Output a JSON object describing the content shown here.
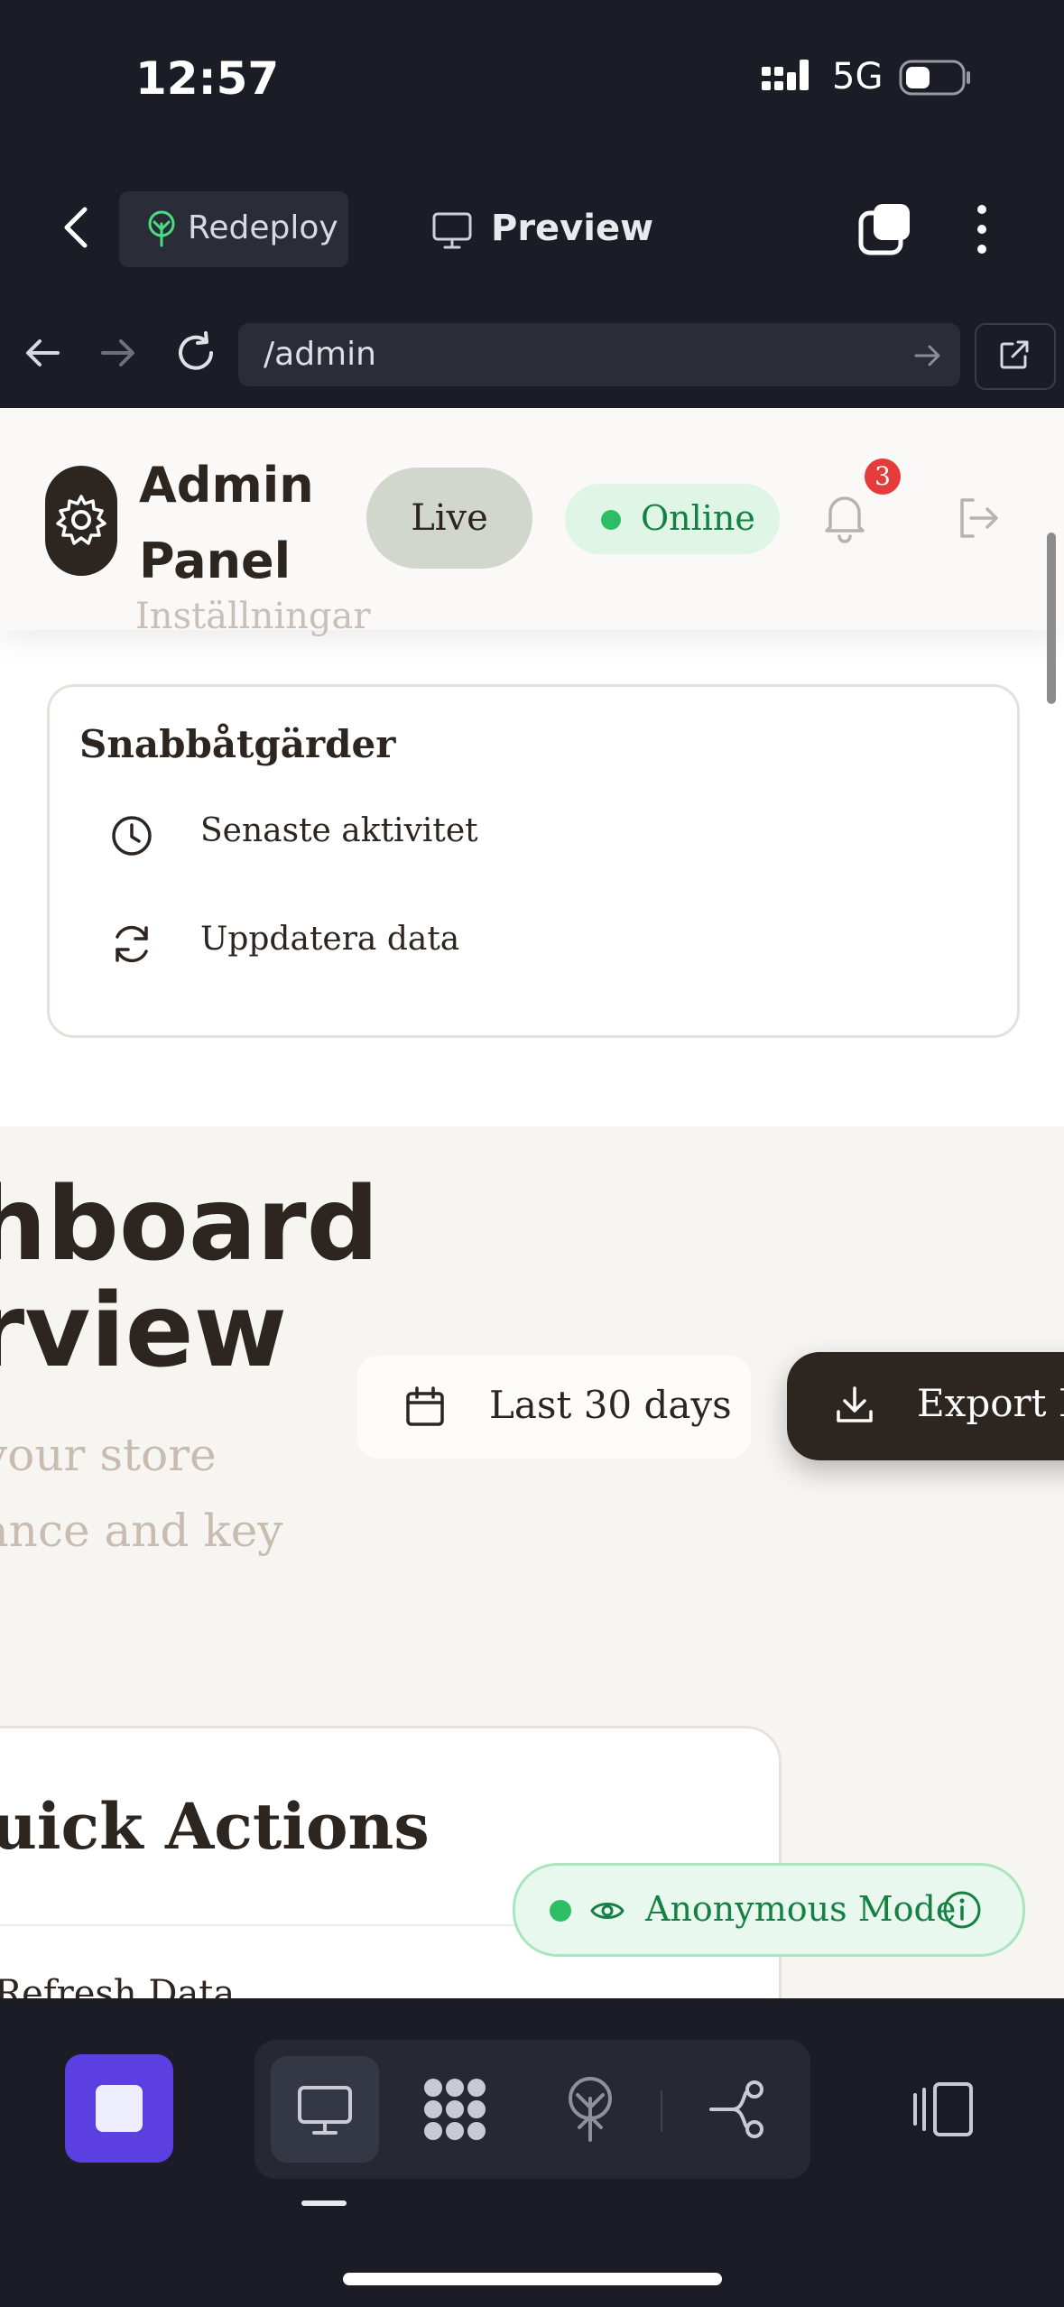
{
  "status_bar": {
    "time": "12:57",
    "network": "5G"
  },
  "app_bar": {
    "redeploy_label": "Redeploy",
    "preview_label": "Preview"
  },
  "url_bar": {
    "url": "/admin"
  },
  "admin_header": {
    "title": "Admin Panel",
    "live_label": "Live",
    "online_label": "Online",
    "notification_count": "3",
    "hidden_text": "Inställningar"
  },
  "quick_menu": {
    "title": "Snabbåtgärder",
    "items": [
      {
        "label": "Senaste aktivitet",
        "icon": "clock-icon"
      },
      {
        "label": "Uppdatera data",
        "icon": "refresh-icon"
      }
    ]
  },
  "dashboard": {
    "heading": "hboard\nrview",
    "subtitle": "your store\nance and key",
    "date_range_label": "Last 30 days",
    "export_label": "Export R"
  },
  "quick_actions_card": {
    "title": "uick Actions",
    "item_label": "Refresh Data"
  },
  "anonymous_badge": {
    "label": "Anonymous Mode"
  },
  "colors": {
    "accent_purple": "#5b3fe0",
    "online_green": "#2dbe64",
    "brand_dark": "#2c2520",
    "badge_red": "#e43b3b"
  }
}
